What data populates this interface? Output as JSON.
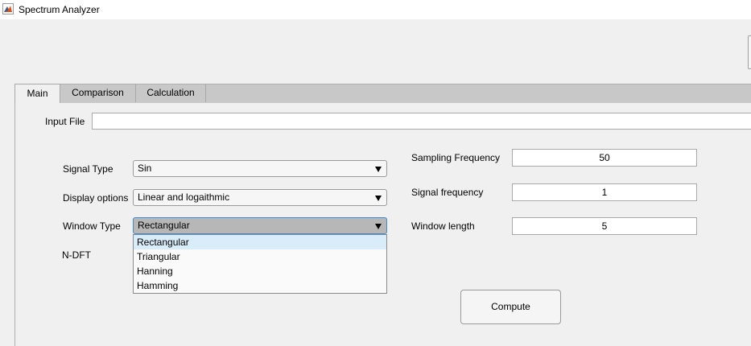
{
  "window": {
    "title": "Spectrum Analyzer",
    "icon": "matlab-icon"
  },
  "tabs": [
    {
      "label": "Main",
      "active": true
    },
    {
      "label": "Comparison",
      "active": false
    },
    {
      "label": "Calculation",
      "active": false
    }
  ],
  "main": {
    "input_file": {
      "label": "Input File",
      "value": ""
    },
    "signal_type": {
      "label": "Signal Type",
      "selected": "Sin"
    },
    "display_options": {
      "label": "Display options",
      "selected": "Linear and logaithmic"
    },
    "window_type": {
      "label": "Window Type",
      "selected": "Rectangular",
      "options": [
        "Rectangular",
        "Triangular",
        "Hanning",
        "Hamming"
      ]
    },
    "n_dft": {
      "label": "N-DFT"
    },
    "sampling_frequency": {
      "label": "Sampling Frequency",
      "value": "50"
    },
    "signal_frequency": {
      "label": "Signal frequency",
      "value": "1"
    },
    "window_length": {
      "label": "Window length",
      "value": "5"
    },
    "compute_label": "Compute"
  },
  "colors": {
    "background": "#f0f0f0",
    "tabstrip": "#c8c8c8",
    "open_popup": "#b7b7b7",
    "focus_border": "#3a8bd8",
    "selected_option": "#d9ecf9"
  }
}
